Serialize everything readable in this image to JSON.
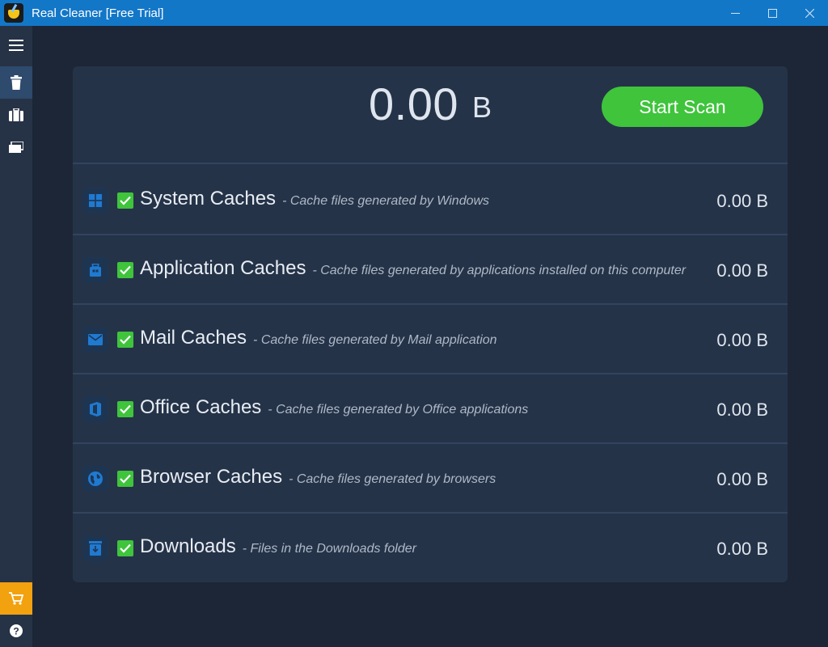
{
  "window": {
    "title": "Real Cleaner [Free Trial]",
    "minimize_glyph": "minimize-icon",
    "maximize_glyph": "maximize-icon",
    "close_glyph": "close-icon"
  },
  "sidebar": {
    "items": [
      {
        "icon": "menu-icon"
      },
      {
        "icon": "trash-icon",
        "active": true
      },
      {
        "icon": "suitcase-icon"
      },
      {
        "icon": "windows-stack-icon"
      }
    ],
    "bottom": [
      {
        "icon": "cart-icon"
      },
      {
        "icon": "help-icon"
      }
    ]
  },
  "summary": {
    "total_value": "0.00",
    "total_unit": "B",
    "scan_label": "Start Scan"
  },
  "categories": [
    {
      "name": "System Caches",
      "desc": "- Cache files generated by Windows",
      "size": "0.00 B",
      "icon": "windows-icon",
      "checked": true
    },
    {
      "name": "Application Caches",
      "desc": "- Cache files generated by applications installed on this computer",
      "size": "0.00 B",
      "icon": "app-icon",
      "checked": true
    },
    {
      "name": "Mail Caches",
      "desc": "- Cache files generated by Mail application",
      "size": "0.00 B",
      "icon": "mail-icon",
      "checked": true
    },
    {
      "name": "Office Caches",
      "desc": " - Cache files generated by Office applications",
      "size": "0.00 B",
      "icon": "office-icon",
      "checked": true
    },
    {
      "name": "Browser Caches",
      "desc": "- Cache files generated by browsers",
      "size": "0.00 B",
      "icon": "globe-icon",
      "checked": true
    },
    {
      "name": "Downloads",
      "desc": "- Files in the Downloads folder",
      "size": "0.00 B",
      "icon": "download-box-icon",
      "checked": true
    }
  ],
  "colors": {
    "titlebar": "#1377c8",
    "background": "#1c2636",
    "panel": "#253348",
    "accent_green": "#3fc43c",
    "cart": "#f2a10f",
    "icon_blue": "#1f7ad1"
  }
}
